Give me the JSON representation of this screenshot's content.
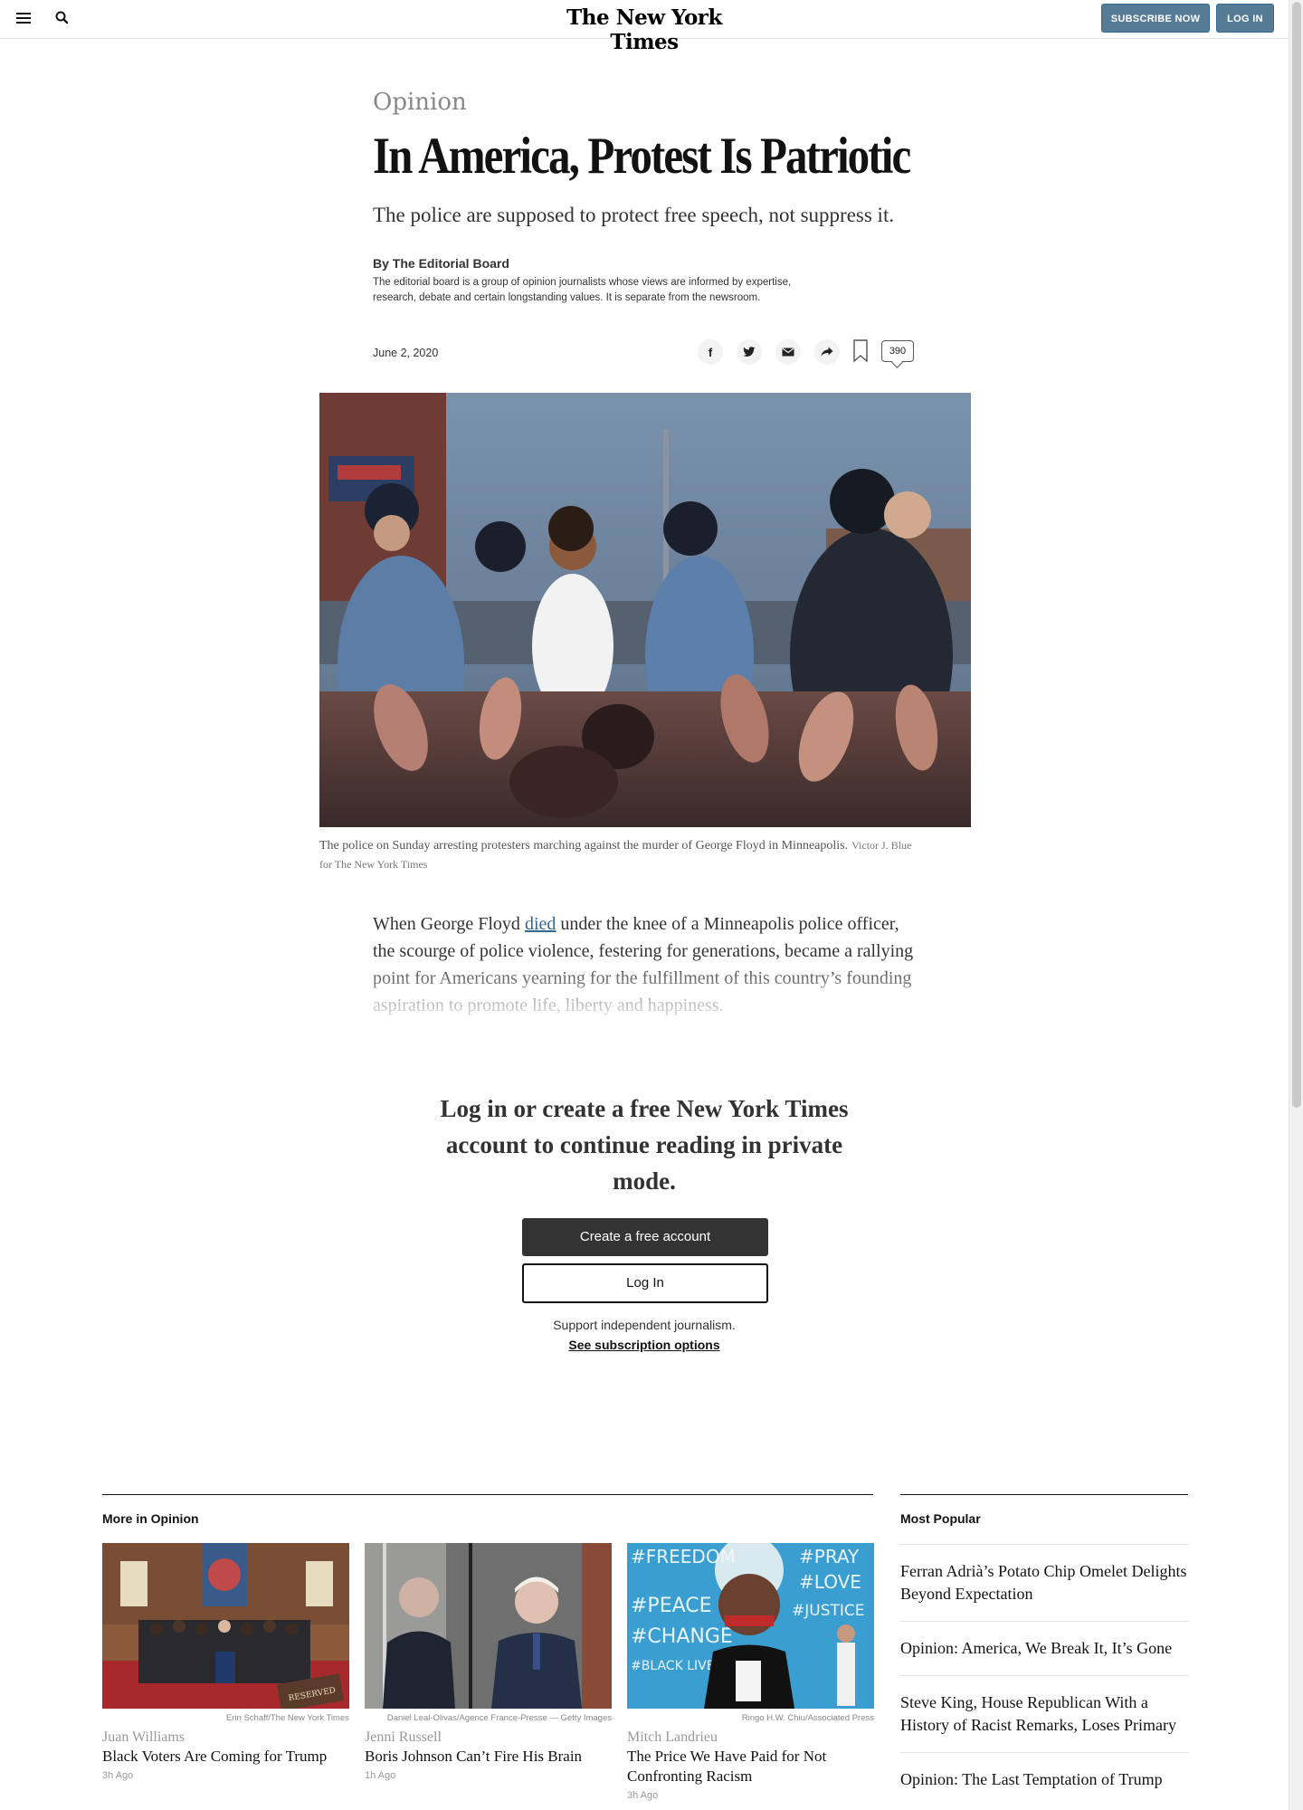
{
  "header": {
    "logo": "The New York Times",
    "subscribe_label": "SUBSCRIBE NOW",
    "login_label": "LOG IN"
  },
  "article": {
    "kicker": "Opinion",
    "headline": "In America, Protest Is Patriotic",
    "summary": "The police are supposed to protect free speech, not suppress it.",
    "byline": "By The Editorial Board",
    "bio": "The editorial board is a group of opinion journalists whose views are informed by expertise, research, debate and certain longstanding values. It is separate from the newsroom.",
    "date": "June 2, 2020",
    "comment_count": "390",
    "share_icons": [
      "facebook-icon",
      "twitter-icon",
      "email-icon",
      "share-icon"
    ],
    "caption": "The police on Sunday arresting protesters marching against the murder of George Floyd in Minneapolis.",
    "caption_credit": "Victor J. Blue for The New York Times",
    "body_before_link": "When George Floyd ",
    "body_link": "died",
    "body_after_link": " under the knee of a Minneapolis police officer, the scourge of police violence, festering for generations, became a rallying point for Americans yearning for the fulfillment of this country’s founding aspiration to promote life, liberty and happiness."
  },
  "gate": {
    "title": "Log in or create a free New York Times account to continue reading in private mode.",
    "create_label": "Create a free account",
    "login_label": "Log In",
    "support_text": "Support independent journalism.",
    "subscription_link": "See subscription options"
  },
  "more_in_opinion": {
    "label": "More in Opinion",
    "cards": [
      {
        "credit": "Erin Schaff/The New York Times",
        "author": "Juan Williams",
        "title": "Black Voters Are Coming for Trump",
        "time": "3h Ago"
      },
      {
        "credit": "Daniel Leal-Olivas/Agence France-Presse — Getty Images",
        "author": "Jenni Russell",
        "title": "Boris Johnson Can’t Fire His Brain",
        "time": "1h Ago"
      },
      {
        "credit": "Ringo H.W. Chiu/Associated Press",
        "author": "Mitch Landrieu",
        "title": "The Price We Have Paid for Not Confronting Racism",
        "time": "3h Ago"
      }
    ]
  },
  "most_popular": {
    "label": "Most Popular",
    "items": [
      "Ferran Adrià’s Potato Chip Omelet Delights Beyond Expectation",
      "Opinion: America, We Break It, It’s Gone",
      "Steve King, House Republican With a History of Racist Remarks, Loses Primary",
      "Opinion: The Last Temptation of Trump"
    ]
  },
  "mural_words": [
    "#FREEDOM",
    "#PRAY",
    "#LOVE",
    "#PEACE",
    "#JUSTICE",
    "#CHANGE",
    "#BLACK LIVES MATTER"
  ],
  "church_sign": "RESERVED",
  "colors": {
    "accent": "#567b95",
    "link": "#326891",
    "dark_button": "#333333"
  }
}
